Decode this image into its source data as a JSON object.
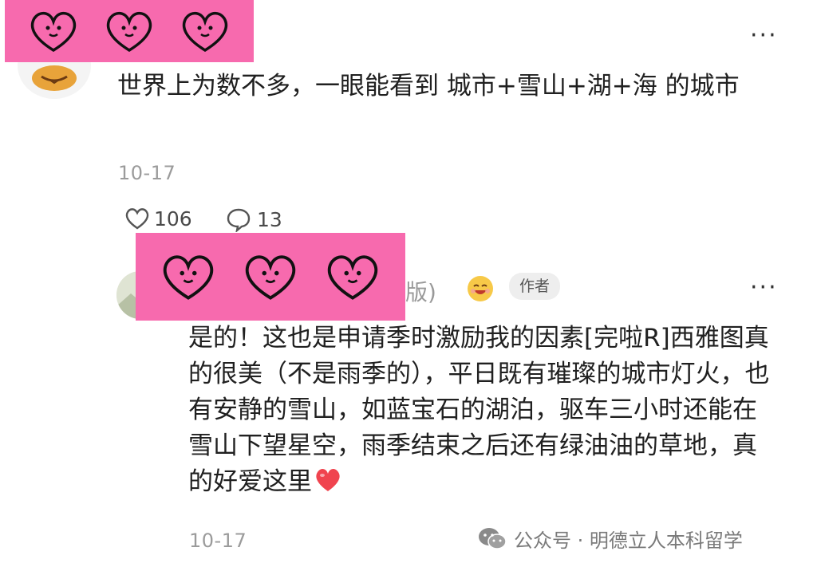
{
  "comment": {
    "text": "世界上为数不多，一眼能看到 城市+雪山+湖+海 的城市",
    "date": "10-17",
    "likes": "106",
    "replies": "13"
  },
  "reply": {
    "username_partial": "版)",
    "author_badge": "作者",
    "text": "是的！这也是申请季时激励我的因素[完啦R]西雅图真的很美（不是雨季的），平日既有璀璨的城市灯火，也有安静的雪山，如蓝宝石的湖泊，驱车三小时还能在雪山下望星空，雨季结束之后还有绿油油的草地，真的好爱这里",
    "date": "10-17"
  },
  "more_label": "···",
  "watermark": {
    "text": "公众号 · 明德立人本科留学"
  },
  "icons": {
    "like": "heart-outline-icon",
    "comment": "speech-bubble-icon",
    "emoji": "grinning-face-icon",
    "red_heart": "red-heart-emoji",
    "wechat": "wechat-logo-icon",
    "sticker": "doodle-heart-face-sticker"
  },
  "colors": {
    "censor_pink": "#f76aae",
    "heart_red": "#f0444f",
    "text": "#202020",
    "muted": "#9b9b9b"
  }
}
